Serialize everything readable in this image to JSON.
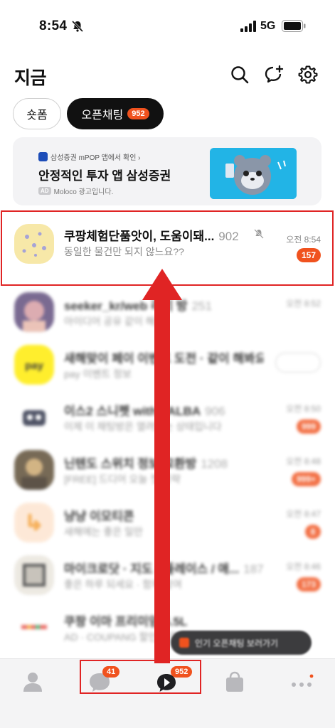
{
  "status_bar": {
    "time": "8:54",
    "network": "5G"
  },
  "header": {
    "title": "지금"
  },
  "filters": {
    "items": [
      {
        "label": "숏폼"
      },
      {
        "label": "오픈채팅",
        "badge": "952"
      }
    ]
  },
  "ad": {
    "source": "삼성증권 mPOP 앱에서 확인 ›",
    "title": "안정적인 투자 앱 삼성증권",
    "tag": "AD",
    "sponsor": "Moloco 광고입니다."
  },
  "chats": [
    {
      "name": "쿠팡체험단품앗이, 도움이돼...",
      "count": "902",
      "message": "동일한 물건만 되지 않느요??",
      "time": "오전 8:54",
      "unread": "157"
    },
    {
      "name": "seeker_kr/web 리기 방",
      "count": "251",
      "message": "아이디어 공유 같이 해요",
      "time": "오전 8:52",
      "unread": ""
    },
    {
      "name": "새해맞이 페이 이벤트 도전 · 같이 해봐요",
      "count": "",
      "message": "pay 이벤트 정보",
      "time": "",
      "unread": ""
    },
    {
      "name": "이스2 스니펫 with TALBA",
      "count": "906",
      "message": "이제 이 채팅방은 열려있는 상태입니다",
      "time": "오전 8:50",
      "unread": "999"
    },
    {
      "name": "닌텐도 스위치 정보 교환방",
      "count": "1208",
      "message": "[FREE] 드디어 오늘 첫 공략",
      "time": "오전 8:48",
      "unread": "999+"
    },
    {
      "name": "냥냥 이모티콘",
      "count": "",
      "message": "새해에는 좋은 일만",
      "time": "오전 8:47",
      "unread": "8"
    },
    {
      "name": "마이크로닷 · 지도 · 플레이스 / 애...",
      "count": "187",
      "message": "좋은 하루 되세요 · 함께 참여",
      "time": "오전 8:46",
      "unread": "173"
    },
    {
      "name": "쿠팡 이마 프리미엄 5.5L",
      "count": "",
      "message": "AD · COUPANG 할인 상품",
      "time": "",
      "unread": ""
    }
  ],
  "toast": {
    "text": "인기 오픈채팅 보러가기"
  },
  "tabbar": {
    "chats_badge": "41",
    "openchat_badge": "952"
  },
  "colors": {
    "accent": "#f0521e",
    "highlight": "#e02424",
    "ad_image": "#22b4e6"
  }
}
